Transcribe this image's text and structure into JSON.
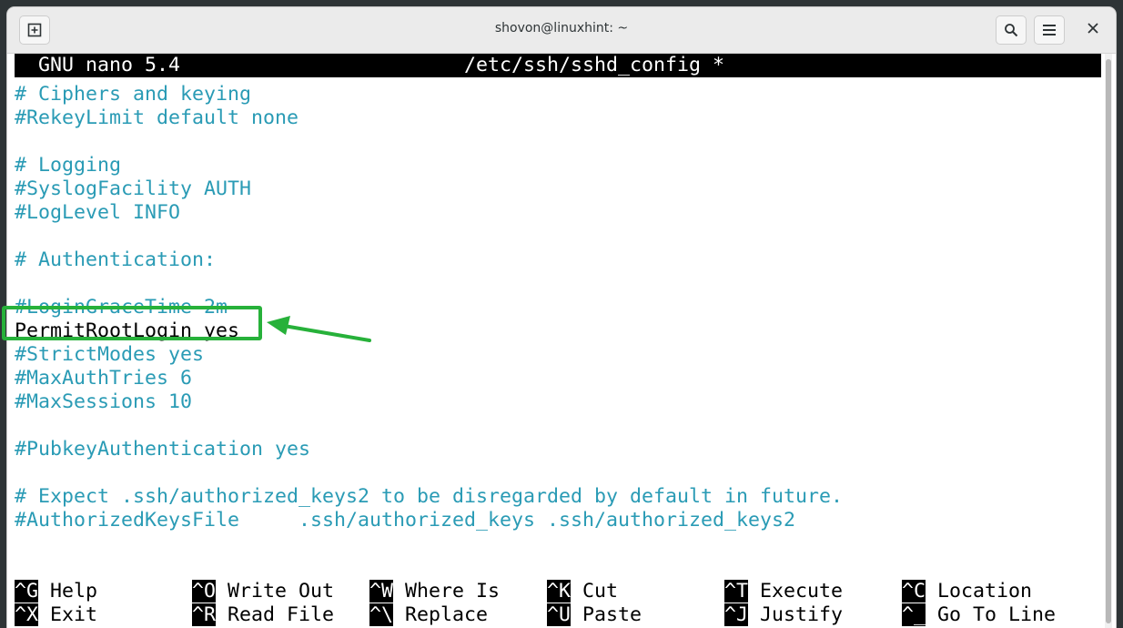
{
  "window": {
    "title": "shovon@linuxhint: ~",
    "new_tab_icon": "new-tab-icon",
    "search_icon": "search-icon",
    "menu_icon": "hamburger-menu-icon",
    "close_icon": "close-icon"
  },
  "nano": {
    "version": "GNU nano 5.4",
    "filename": "/etc/ssh/sshd_config *"
  },
  "lines": [
    "# Ciphers and keying",
    "#RekeyLimit default none",
    "",
    "# Logging",
    "#SyslogFacility AUTH",
    "#LogLevel INFO",
    "",
    "# Authentication:",
    "",
    "#LoginGraceTime 2m",
    "PermitRootLogin yes",
    "#StrictModes yes",
    "#MaxAuthTries 6",
    "#MaxSessions 10",
    "",
    "#PubkeyAuthentication yes",
    "",
    "# Expect .ssh/authorized_keys2 to be disregarded by default in future.",
    "#AuthorizedKeysFile     .ssh/authorized_keys .ssh/authorized_keys2"
  ],
  "shortcuts": {
    "row1": [
      {
        "key": "^G",
        "label": "Help"
      },
      {
        "key": "^O",
        "label": "Write Out"
      },
      {
        "key": "^W",
        "label": "Where Is"
      },
      {
        "key": "^K",
        "label": "Cut"
      },
      {
        "key": "^T",
        "label": "Execute"
      },
      {
        "key": "^C",
        "label": "Location"
      }
    ],
    "row2": [
      {
        "key": "^X",
        "label": "Exit"
      },
      {
        "key": "^R",
        "label": "Read File"
      },
      {
        "key": "^\\",
        "label": "Replace"
      },
      {
        "key": "^U",
        "label": "Paste"
      },
      {
        "key": "^J",
        "label": "Justify"
      },
      {
        "key": "^_",
        "label": "Go To Line"
      }
    ]
  },
  "colors": {
    "comment": "#2a9bb5",
    "annotation": "#27b13a"
  }
}
